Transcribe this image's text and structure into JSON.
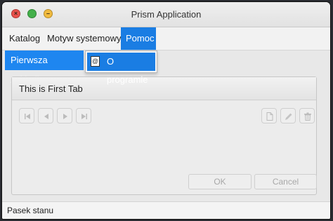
{
  "window": {
    "title": "Prism Application"
  },
  "menubar": {
    "items": [
      {
        "label": "Katalog"
      },
      {
        "label": "Motyw systemowy"
      },
      {
        "label": "Pomoc"
      }
    ]
  },
  "tabs": [
    {
      "label": "Pierwsza zakładka"
    }
  ],
  "dropdown": {
    "item_label": "O programie"
  },
  "panel": {
    "header": "This is First Tab",
    "buttons": {
      "ok": "OK",
      "cancel": "Cancel"
    }
  },
  "statusbar": {
    "text": "Pasek stanu"
  },
  "icons": {
    "nav": [
      "first-icon",
      "previous-icon",
      "next-icon",
      "last-icon"
    ],
    "actions": [
      "new-document-icon",
      "edit-pencil-icon",
      "delete-trash-icon"
    ]
  },
  "colors": {
    "accent": "#1a7de3"
  }
}
